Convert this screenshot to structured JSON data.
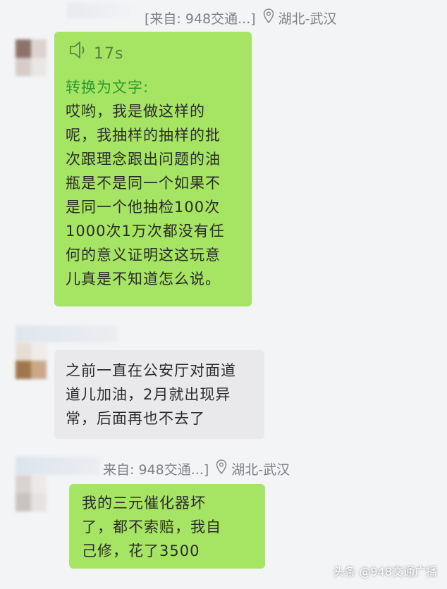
{
  "msg1": {
    "source": "[来自: 948交通...]",
    "location": "湖北-武汉",
    "voice_duration": "17s",
    "convert_label": "转换为文字:",
    "text_lines": [
      "哎哟，我是做这样的",
      "呢，我抽样的抽样的批",
      "次跟理念跟出问题的油",
      "瓶是不是同一个如果不",
      "是同一个他抽检100次",
      "1000次1万次都没有任",
      "何的意义证明这这玩意",
      "儿真是不知道怎么说。"
    ]
  },
  "msg2": {
    "text_lines": [
      "之前一直在公安厅对面道",
      "道儿加油，2月就出现异",
      "常，后面再也不去了"
    ]
  },
  "msg3": {
    "source": "来自: 948交通...]",
    "location": "湖北-武汉",
    "text_lines": [
      "我的三元催化器坏",
      "了，都不索赔，我自",
      "己修，花了3500"
    ]
  },
  "watermark": "头条 @948交通广播",
  "colors": {
    "green_bubble": "#a6e463",
    "grey_bubble": "#e9e9ec",
    "background": "#f3f4f6"
  },
  "icons": [
    "location-pin-icon",
    "speaker-icon"
  ]
}
